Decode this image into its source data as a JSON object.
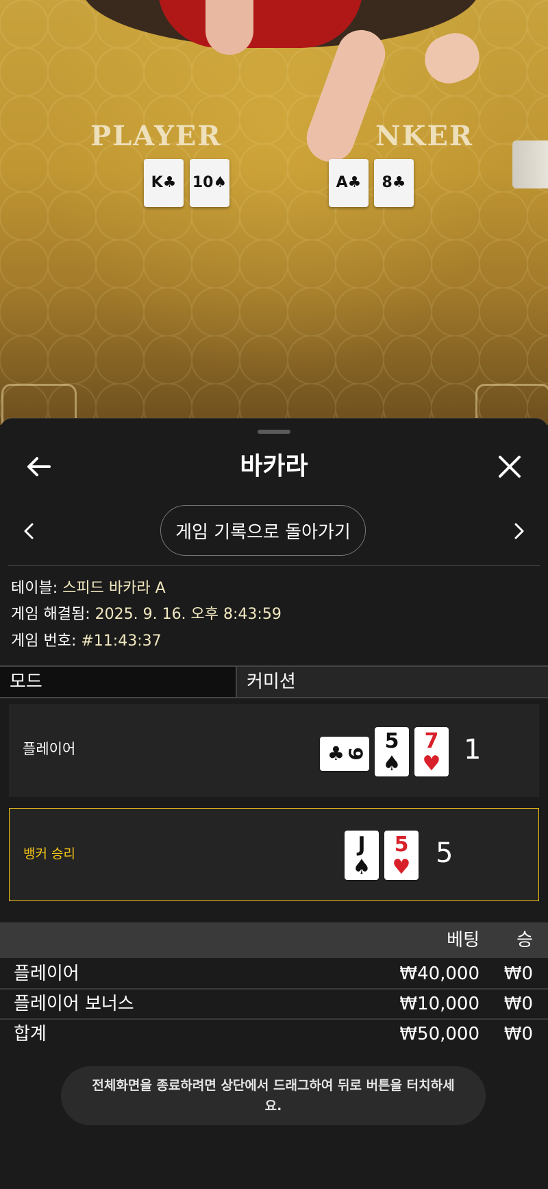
{
  "video": {
    "player_label": "PLAYER",
    "banker_label": "NKER",
    "player_cards": [
      "K♣",
      "10♠"
    ],
    "banker_cards": [
      "A♣",
      "8♣"
    ]
  },
  "sheet": {
    "title": "바카라",
    "back_to_history": "게임 기록으로 돌아가기"
  },
  "info": {
    "table_label": "테이블: ",
    "table_value": "스피드 바카라 A",
    "resolved_label": "게임 해결됨: ",
    "resolved_value": "2025. 9. 16. 오후 8:43:59",
    "number_label": "게임 번호: ",
    "number_value": "#11:43:37"
  },
  "mode": {
    "label": "모드",
    "value": "커미션"
  },
  "hands": {
    "player": {
      "label": "플레이어",
      "total": "1",
      "cards": [
        {
          "rank": "9",
          "suit": "♣",
          "color": "#111111",
          "rotated": true
        },
        {
          "rank": "5",
          "suit": "♠",
          "color": "#111111"
        },
        {
          "rank": "7",
          "suit": "♥",
          "color": "#d8202a"
        }
      ]
    },
    "banker": {
      "label": "뱅커 승리",
      "label_color": "#f2c318",
      "total": "5",
      "cards": [
        {
          "rank": "J",
          "suit": "♠",
          "color": "#111111"
        },
        {
          "rank": "5",
          "suit": "♥",
          "color": "#d8202a"
        }
      ]
    }
  },
  "bets": {
    "col_bet": "베팅",
    "col_win": "승",
    "rows": [
      {
        "name": "플레이어",
        "bet": "₩40,000",
        "win": "₩0"
      },
      {
        "name": "플레이어 보너스",
        "bet": "₩10,000",
        "win": "₩0"
      }
    ],
    "total": {
      "name": "합계",
      "bet": "₩50,000",
      "win": "₩0"
    }
  },
  "toast": {
    "text": "전체화면을 종료하려면 상단에서 드래그하여 뒤로 버튼을 터치하세요."
  },
  "colors": {
    "accent_gold": "#f2c318",
    "sheet_bg": "#1b1b1b"
  }
}
